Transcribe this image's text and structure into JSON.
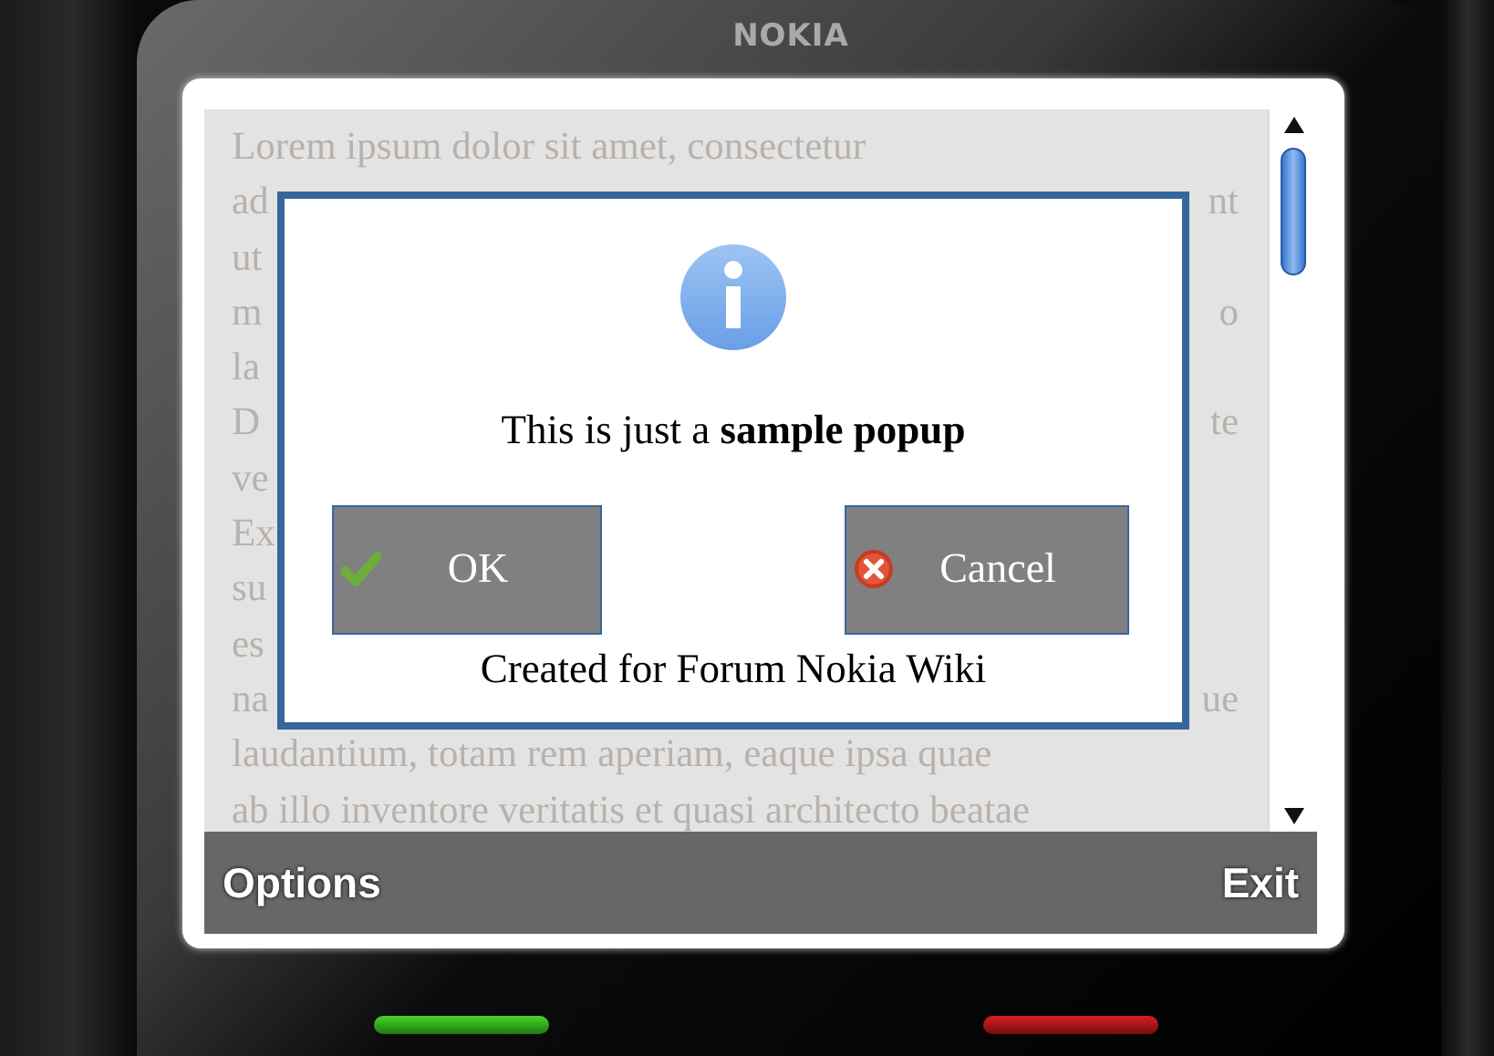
{
  "phone": {
    "brand": "NOKIA"
  },
  "screen": {
    "text_lines": [
      {
        "left": "Lorem ipsum dolor sit amet, consectetur"
      },
      {
        "left": "ad",
        "right": "nt"
      },
      {
        "left": "ut"
      },
      {
        "left": "m",
        "right": "o"
      },
      {
        "left": "la"
      },
      {
        "left": "D",
        "right": "te"
      },
      {
        "left": "ve"
      },
      {
        "left": "Ex"
      },
      {
        "left": "su"
      },
      {
        "left": "es"
      },
      {
        "left": "na",
        "right": "ue"
      },
      {
        "left": "laudantium, totam rem aperiam, eaque ipsa quae"
      },
      {
        "left": "ab illo inventore veritatis et quasi architecto beatae"
      }
    ]
  },
  "popup": {
    "message": "This is just a **sample popup**",
    "buttons": [
      {
        "label": "OK",
        "kind": "confirm"
      },
      {
        "label": "Cancel",
        "kind": "cancel"
      }
    ],
    "footer": "Created for Forum Nokia Wiki"
  },
  "softkeys": {
    "left": "Options",
    "right": "Exit"
  }
}
